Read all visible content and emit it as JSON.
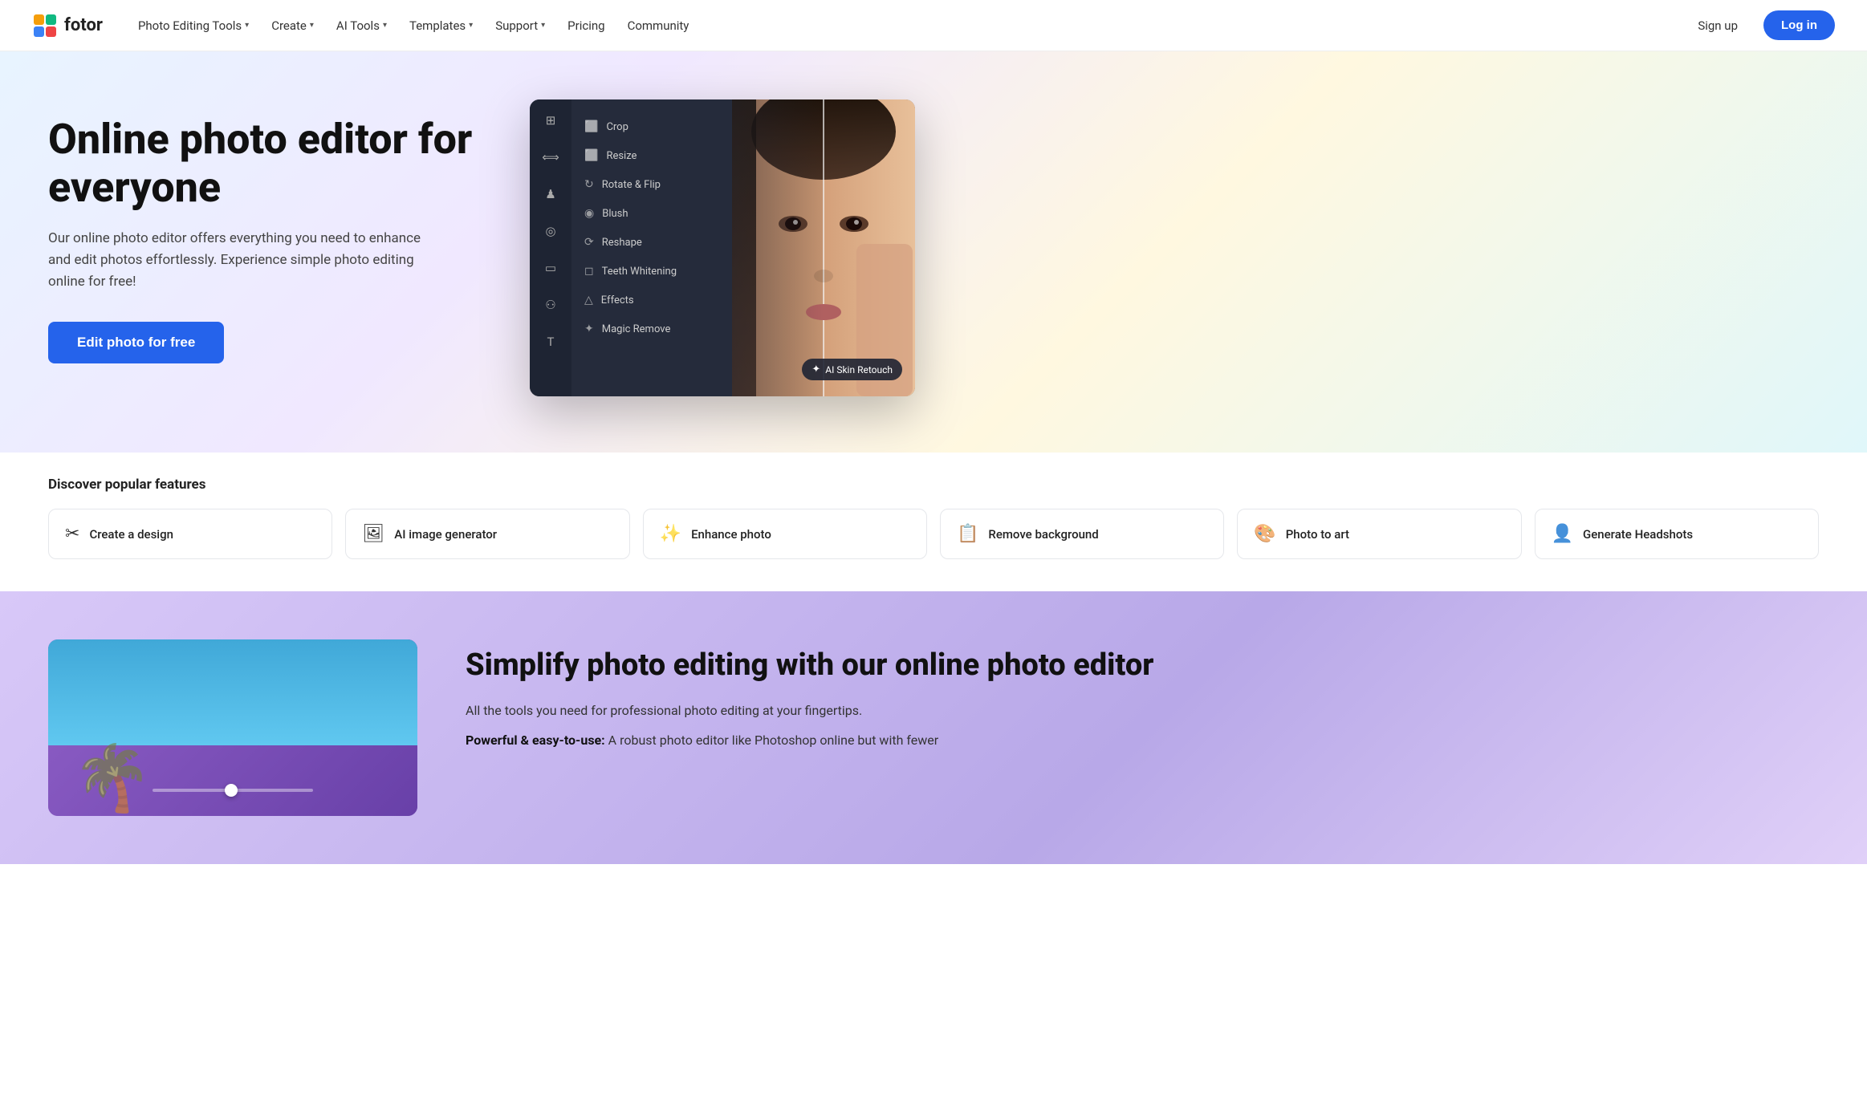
{
  "nav": {
    "logo_text": "fotor",
    "links": [
      {
        "label": "Photo Editing Tools",
        "has_dropdown": true
      },
      {
        "label": "Create",
        "has_dropdown": true
      },
      {
        "label": "AI Tools",
        "has_dropdown": true
      },
      {
        "label": "Templates",
        "has_dropdown": true
      },
      {
        "label": "Support",
        "has_dropdown": true
      },
      {
        "label": "Pricing",
        "has_dropdown": false
      },
      {
        "label": "Community",
        "has_dropdown": false
      }
    ],
    "signup_label": "Sign up",
    "login_label": "Log in"
  },
  "hero": {
    "title": "Online photo editor for everyone",
    "description": "Our online photo editor offers everything you need to enhance and edit photos effortlessly. Experience simple photo editing online for free!",
    "cta_label": "Edit photo for free",
    "editor_panel_items": [
      {
        "icon": "⬜",
        "label": "Crop"
      },
      {
        "icon": "⬜",
        "label": "Resize"
      },
      {
        "icon": "↻",
        "label": "Rotate & Flip"
      },
      {
        "icon": "⬜",
        "label": "Blush"
      },
      {
        "icon": "⬜",
        "label": "Reshape"
      },
      {
        "icon": "⬜",
        "label": "Teeth Whitening"
      },
      {
        "icon": "⬜",
        "label": "Effects"
      },
      {
        "icon": "⬜",
        "label": "Magic Remove"
      }
    ],
    "ai_badge": "AI Skin Retouch"
  },
  "features": {
    "section_title": "Discover popular features",
    "cards": [
      {
        "icon": "✂",
        "label": "Create a design"
      },
      {
        "icon": "🖼",
        "label": "AI image generator"
      },
      {
        "icon": "✨",
        "label": "Enhance photo"
      },
      {
        "icon": "📋",
        "label": "Remove background"
      },
      {
        "icon": "🎨",
        "label": "Photo to art"
      },
      {
        "icon": "👤",
        "label": "Generate Headshots"
      }
    ]
  },
  "second_section": {
    "title": "Simplify photo editing with our online photo editor",
    "description": "All the tools you need for professional photo editing at your fingertips.",
    "bold_text": "Powerful & easy-to-use:",
    "bold_suffix": " A robust photo editor like Photoshop online but with fewer"
  }
}
